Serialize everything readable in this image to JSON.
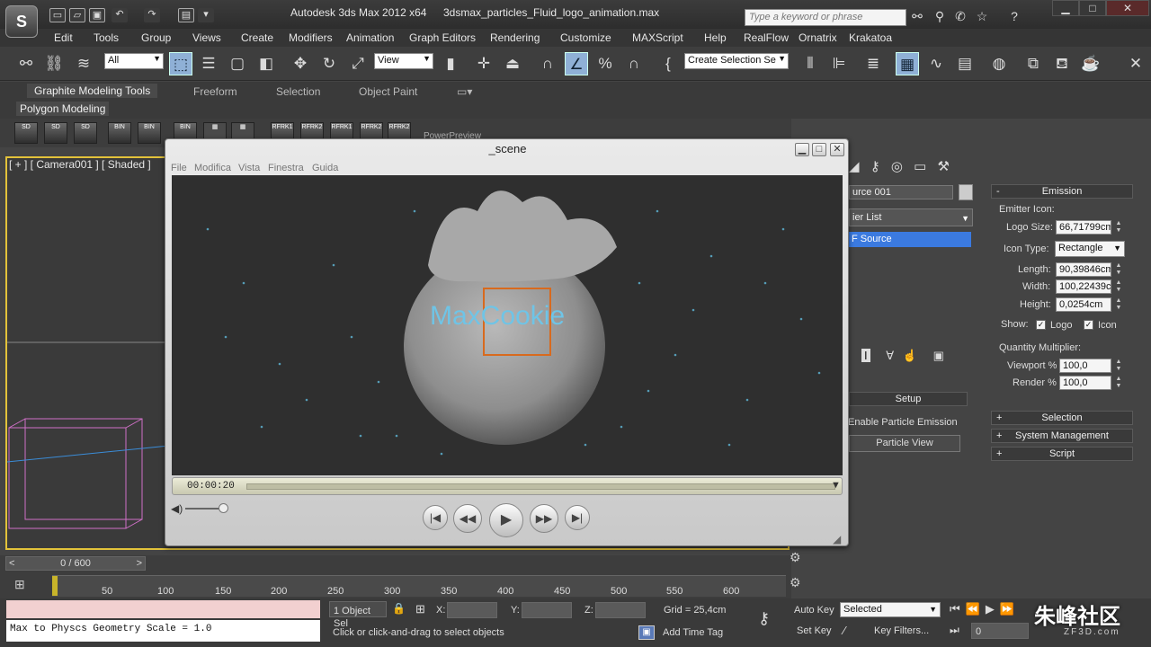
{
  "app": {
    "title": "Autodesk 3ds Max  2012 x64",
    "file": "3dsmax_particles_Fluid_logo_animation.max",
    "logo": "S",
    "search_placeholder": "Type a keyword or phrase"
  },
  "menu": [
    "Edit",
    "Tools",
    "Group",
    "Views",
    "Create",
    "Modifiers",
    "Animation",
    "Graph Editors",
    "Rendering",
    "Customize",
    "MAXScript",
    "Help",
    "RealFlow",
    "Ornatrix",
    "Krakatoa"
  ],
  "toolbar": {
    "selection_filter": "All",
    "ref_coord": "View",
    "named_selection": "Create Selection Se"
  },
  "ribbon": {
    "tabs": [
      "Graphite Modeling Tools",
      "Freeform",
      "Selection",
      "Object Paint"
    ],
    "active_tab": "Graphite Modeling Tools",
    "subpanel": "Polygon Modeling",
    "icon_labels": [
      "SD",
      "SD",
      "SD",
      "BIN",
      "BIN",
      "BIN",
      "RFRK1",
      "RFRK2",
      "RFRK1",
      "RFRK2",
      "RFRK2"
    ],
    "power_preview": "PowerPreview"
  },
  "viewport": {
    "label": "[ + ] [ Camera001 ] [ Shaded ]"
  },
  "player": {
    "title": "_scene",
    "menu": [
      "File",
      "Modifica",
      "Vista",
      "Finestra",
      "Guida"
    ],
    "video_text": "MaxCookie",
    "time": "00:00:20"
  },
  "command_panel": {
    "object_name": "urce 001",
    "modifier_list": "ier List",
    "stack_item": "F Source",
    "setup": {
      "header": "Setup",
      "enable_button": "Enable Particle Emission",
      "particle_view_button": "Particle View"
    },
    "emission": {
      "header": "Emission",
      "group_label": "Emitter Icon:",
      "logo_size_label": "Logo Size:",
      "logo_size": "66,71799cm",
      "icon_type_label": "Icon Type:",
      "icon_type": "Rectangle",
      "length_label": "Length:",
      "length": "90,39846cm",
      "width_label": "Width:",
      "width": "100,22439c",
      "height_label": "Height:",
      "height": "0,0254cm",
      "show_label": "Show:",
      "show_logo": "Logo",
      "show_icon": "Icon",
      "qm_label": "Quantity Multiplier:",
      "viewport_label": "Viewport %",
      "viewport_val": "100,0",
      "render_label": "Render %",
      "render_val": "100,0"
    },
    "rollouts": [
      "Selection",
      "System Management",
      "Script"
    ]
  },
  "timeline": {
    "frame_display": "0 / 600",
    "ticks": [
      "50",
      "100",
      "150",
      "200",
      "250",
      "300",
      "350",
      "400",
      "450",
      "500",
      "550",
      "600"
    ]
  },
  "status": {
    "maxscript": "Max to Physcs Geometry Scale = 1.0",
    "selected_count": "1 Object Sel",
    "prompt": "Click or click-and-drag to select objects",
    "x_label": "X:",
    "y_label": "Y:",
    "z_label": "Z:",
    "grid": "Grid = 25,4cm",
    "add_time_tag": "Add Time Tag",
    "auto_key": "Auto Key",
    "set_key": "Set Key",
    "key_mode": "Selected",
    "key_filters": "Key Filters...",
    "current_frame": "0"
  },
  "watermark": {
    "main": "朱峰社区",
    "sub": "ZF3D.com"
  }
}
